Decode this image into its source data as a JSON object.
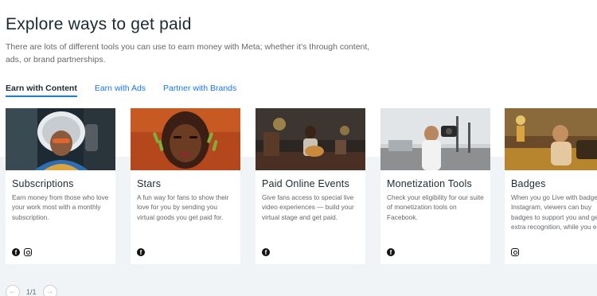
{
  "header": {
    "title": "Explore ways to get paid",
    "description": "There are lots of different tools you can use to earn money with Meta; whether it’s through content, ads, or brand partnerships."
  },
  "tabs": [
    {
      "label": "Earn with Content",
      "active": true
    },
    {
      "label": "Earn with Ads",
      "active": false
    },
    {
      "label": "Partner with Brands",
      "active": false
    }
  ],
  "cards": [
    {
      "title": "Subscriptions",
      "lines": [
        "Earn money from those who love",
        "your work most with a monthly",
        "subscription."
      ],
      "icons": [
        "facebook-icon",
        "instagram-icon"
      ]
    },
    {
      "title": "Stars",
      "lines": [
        "A fun way for fans to show their",
        "love for you by sending you",
        "virtual goods you get paid for."
      ],
      "icons": [
        "facebook-icon"
      ]
    },
    {
      "title": "Paid Online Events",
      "lines": [
        "Give fans access to special live",
        "video experiences — build your",
        "virtual stage and get paid."
      ],
      "icons": [
        "facebook-icon"
      ]
    },
    {
      "title": "Monetization Tools",
      "lines": [
        "Check your eligibility for our suite",
        "of monetization tools on",
        "Facebook."
      ],
      "icons": [
        "facebook-icon"
      ]
    },
    {
      "title": "Badges",
      "lines": [
        "When you go Live with badges",
        "Instagram, viewers can buy",
        "badges to support you and get",
        "extra recognition, while you ea"
      ],
      "icons": [
        "instagram-icon"
      ]
    }
  ],
  "pager": {
    "count": "1/1",
    "prev_icon": "arrow-left-icon",
    "next_icon": "arrow-right-icon"
  }
}
